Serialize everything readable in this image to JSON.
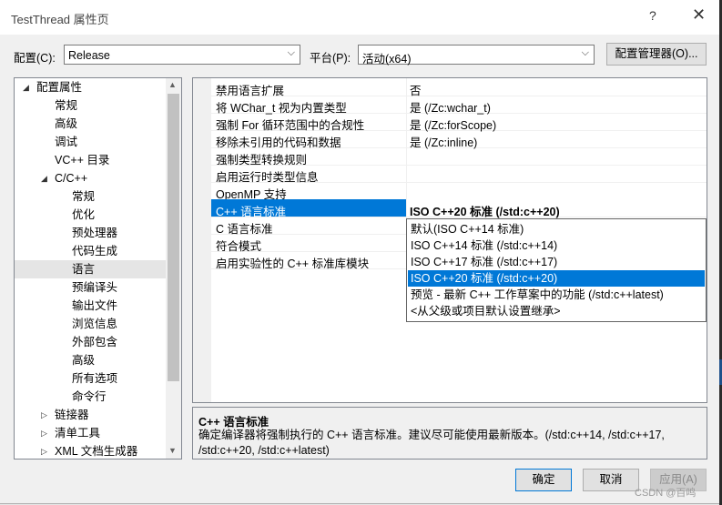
{
  "window": {
    "title": "TestThread 属性页",
    "help_glyph": "?",
    "close_glyph": "✕"
  },
  "config_bar": {
    "config_label": "配置(C):",
    "config_value": "Release",
    "platform_label": "平台(P):",
    "platform_value": "活动(x64)",
    "manager_button": "配置管理器(O)..."
  },
  "tree": {
    "items": [
      {
        "label": "配置属性",
        "level": 0,
        "expander": "◢"
      },
      {
        "label": "常规",
        "level": 1
      },
      {
        "label": "高级",
        "level": 1
      },
      {
        "label": "调试",
        "level": 1
      },
      {
        "label": "VC++ 目录",
        "level": 1
      },
      {
        "label": "C/C++",
        "level": 1,
        "expander": "◢"
      },
      {
        "label": "常规",
        "level": 2
      },
      {
        "label": "优化",
        "level": 2
      },
      {
        "label": "预处理器",
        "level": 2
      },
      {
        "label": "代码生成",
        "level": 2
      },
      {
        "label": "语言",
        "level": 2,
        "selected": true
      },
      {
        "label": "预编译头",
        "level": 2
      },
      {
        "label": "输出文件",
        "level": 2
      },
      {
        "label": "浏览信息",
        "level": 2
      },
      {
        "label": "外部包含",
        "level": 2
      },
      {
        "label": "高级",
        "level": 2
      },
      {
        "label": "所有选项",
        "level": 2
      },
      {
        "label": "命令行",
        "level": 2
      },
      {
        "label": "链接器",
        "level": 1,
        "expander": "▷"
      },
      {
        "label": "清单工具",
        "level": 1,
        "expander": "▷"
      },
      {
        "label": "XML 文档生成器",
        "level": 1,
        "expander": "▷"
      }
    ]
  },
  "properties": {
    "rows": [
      {
        "name": "禁用语言扩展",
        "value": "否"
      },
      {
        "name": "将 WChar_t 视为内置类型",
        "value": "是 (/Zc:wchar_t)"
      },
      {
        "name": "强制 For 循环范围中的合规性",
        "value": "是 (/Zc:forScope)"
      },
      {
        "name": "移除未引用的代码和数据",
        "value": "是 (/Zc:inline)"
      },
      {
        "name": "强制类型转换规则",
        "value": ""
      },
      {
        "name": "启用运行时类型信息",
        "value": ""
      },
      {
        "name": "OpenMP 支持",
        "value": ""
      },
      {
        "name": "C++ 语言标准",
        "value": "ISO C++20 标准 (/std:c++20)",
        "selected": true
      },
      {
        "name": "C 语言标准",
        "value": ""
      },
      {
        "name": "符合模式",
        "value": ""
      },
      {
        "name": "启用实验性的 C++ 标准库模块",
        "value": ""
      }
    ]
  },
  "dropdown": {
    "options": [
      "默认(ISO C++14 标准)",
      "ISO C++14 标准 (/std:c++14)",
      "ISO C++17 标准 (/std:c++17)",
      "ISO C++20 标准 (/std:c++20)",
      "预览 - 最新 C++ 工作草案中的功能 (/std:c++latest)",
      "<从父级或项目默认设置继承>"
    ],
    "selected_index": 3
  },
  "description": {
    "title": "C++ 语言标准",
    "text": "确定编译器将强制执行的 C++ 语言标准。建议尽可能使用最新版本。(/std:c++14, /std:c++17, /std:c++20, /std:c++latest)"
  },
  "buttons": {
    "ok": "确定",
    "cancel": "取消",
    "apply": "应用(A)"
  },
  "watermark": "CSDN @百鸣",
  "colors": {
    "selection": "#0078d7",
    "tree_selection": "#e5e5e5",
    "dialog_bg": "#f0f0f0"
  }
}
